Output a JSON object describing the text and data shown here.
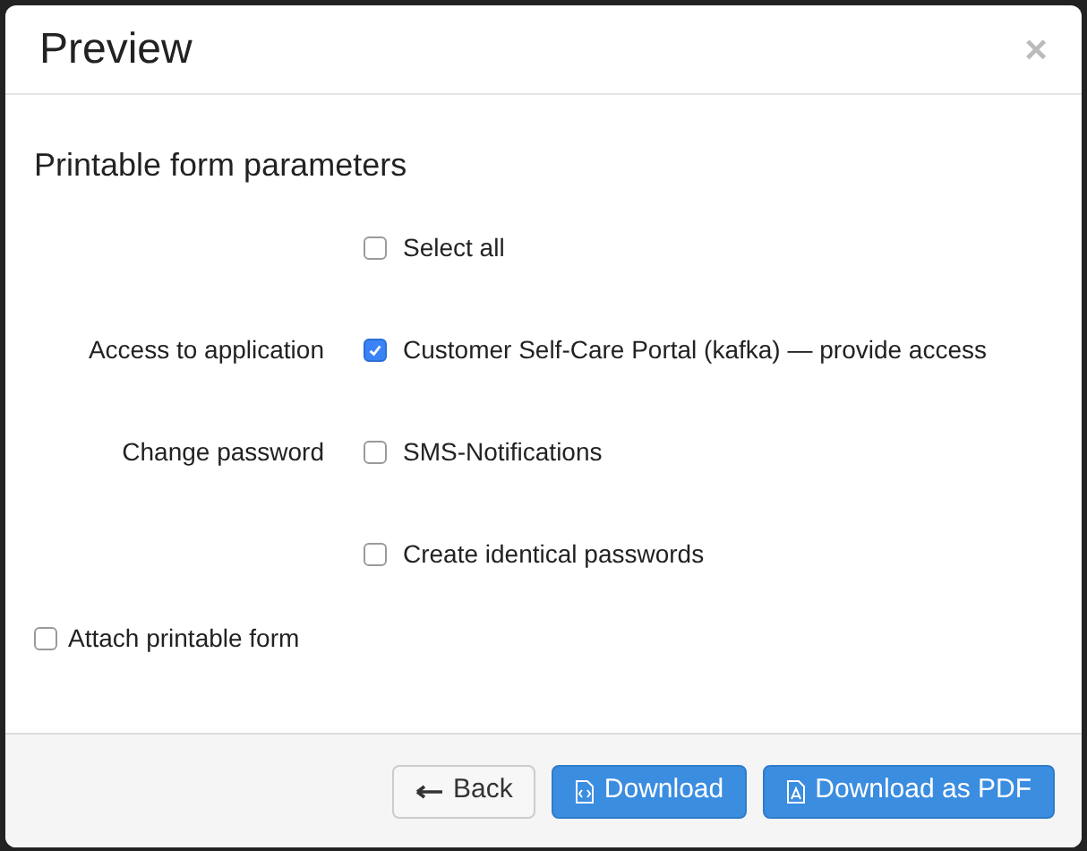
{
  "dialog": {
    "title": "Preview",
    "close": "×"
  },
  "section_title": "Printable form parameters",
  "rows": [
    {
      "label": "",
      "option": "Select all",
      "checked": false
    },
    {
      "label": "Access to application",
      "option": "Customer Self-Care Portal (kafka) — provide access",
      "checked": true
    },
    {
      "label": "Change password",
      "option": "SMS-Notifications",
      "checked": false
    },
    {
      "label": "",
      "option": "Create identical passwords",
      "checked": false
    }
  ],
  "attach": {
    "option": "Attach printable form",
    "checked": false
  },
  "buttons": [
    {
      "label": "Back",
      "kind": "back"
    },
    {
      "label": "Download",
      "kind": "download"
    },
    {
      "label": "Download as PDF",
      "kind": "pdf"
    }
  ]
}
